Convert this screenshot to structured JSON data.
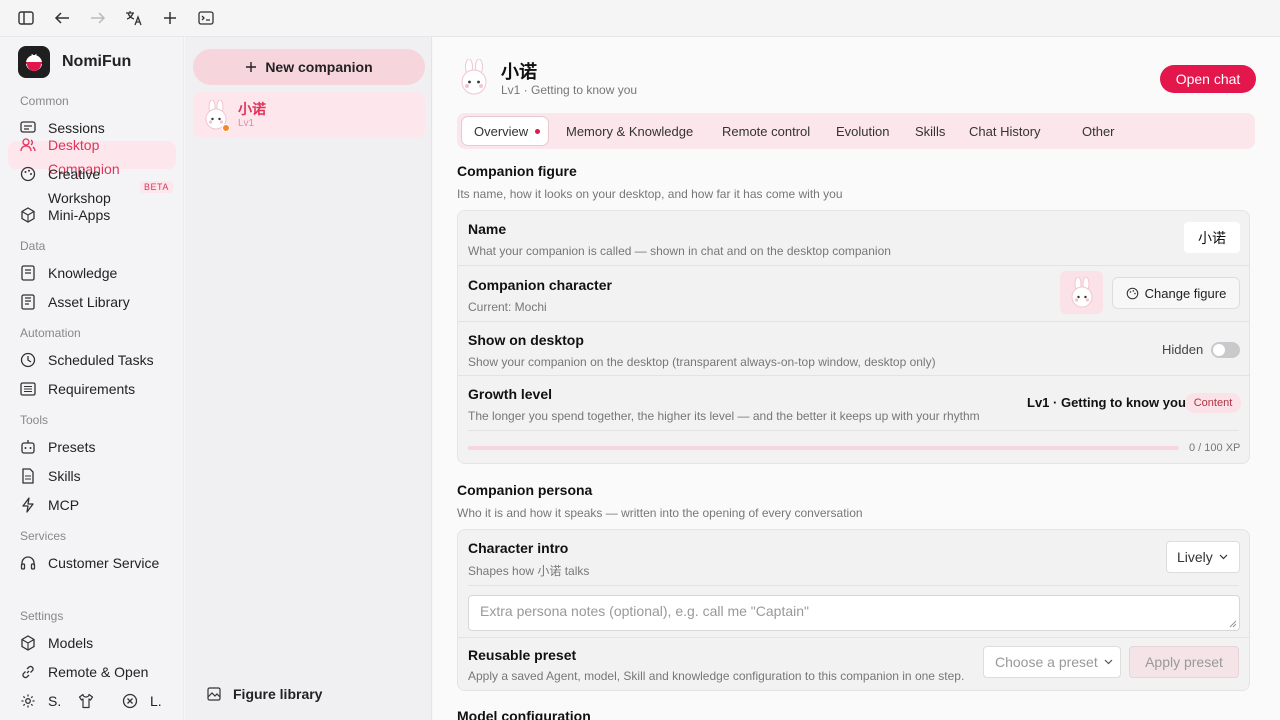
{
  "toolbar": {
    "icons": [
      "sidebar-toggle-icon",
      "back-arrow-icon",
      "forward-arrow-icon",
      "translate-icon",
      "plus-icon",
      "terminal-icon"
    ]
  },
  "sidebar": {
    "brand": "NomiFun",
    "sections": {
      "common": "Common",
      "data": "Data",
      "automation": "Automation",
      "tools": "Tools",
      "services": "Services",
      "settings": "Settings"
    },
    "items": {
      "sessions": "Sessions",
      "desktop_companion_1": "Desktop",
      "desktop_companion_2": "Companion",
      "creative_workshop_1": "Creative",
      "creative_workshop_2": "Workshop",
      "mini_apps": "Mini-Apps",
      "knowledge": "Knowledge",
      "asset_library": "Asset Library",
      "scheduled_tasks": "Scheduled Tasks",
      "requirements": "Requirements",
      "presets": "Presets",
      "skills": "Skills",
      "mcp": "MCP",
      "customer_service": "Customer Service",
      "models": "Models",
      "remote_open": "Remote & Open",
      "bottom_s": "S.",
      "bottom_l": "L."
    },
    "beta_badge": "BETA",
    "accent": "#e0335a"
  },
  "companion_list": {
    "new_button": "New companion",
    "items": [
      {
        "name": "小诺",
        "level": "Lv1",
        "status_color": "#f08a24"
      }
    ],
    "figure_library": "Figure library"
  },
  "header": {
    "name": "小诺",
    "subtitle": "Lv1 · Getting to know you",
    "open_chat": "Open chat",
    "accent": "#e3174c"
  },
  "tabs": [
    {
      "label": "Overview",
      "active": true
    },
    {
      "label": "Memory & Knowledge"
    },
    {
      "label": "Remote control"
    },
    {
      "label": "Evolution"
    },
    {
      "label": "Skills"
    },
    {
      "label": "Chat History"
    },
    {
      "label": "Other"
    }
  ],
  "figure_section": {
    "title": "Companion figure",
    "desc": "Its name, how it looks on your desktop, and how far it has come with you",
    "name_row": {
      "title": "Name",
      "desc": "What your companion is called — shown in chat and on the desktop companion",
      "value": "小诺"
    },
    "character_row": {
      "title": "Companion character",
      "desc": "Current: Mochi",
      "button": "Change figure"
    },
    "desktop_row": {
      "title": "Show on desktop",
      "desc": "Show your companion on the desktop (transparent always-on-top window, desktop only)",
      "toggle_label": "Hidden",
      "enabled": false
    },
    "growth_row": {
      "title": "Growth level",
      "desc": "The longer you spend together, the higher its level — and the better it keeps up with your rhythm",
      "level": "Lv1 · Getting to know you",
      "badge": "Content",
      "xp_text": "0 / 100 XP",
      "xp_fraction": 0
    }
  },
  "persona_section": {
    "title": "Companion persona",
    "desc": "Who it is and how it speaks — written into the opening of every conversation",
    "intro_row": {
      "title": "Character intro",
      "desc": "Shapes how 小诺 talks",
      "selected": "Lively",
      "notes_placeholder": "Extra persona notes (optional), e.g. call me \"Captain\""
    },
    "preset_row": {
      "title": "Reusable preset",
      "desc": "Apply a saved Agent, model, Skill and knowledge configuration to this companion in one step.",
      "select_placeholder": "Choose a preset",
      "apply": "Apply preset"
    }
  },
  "model_section": {
    "title": "Model configuration"
  }
}
